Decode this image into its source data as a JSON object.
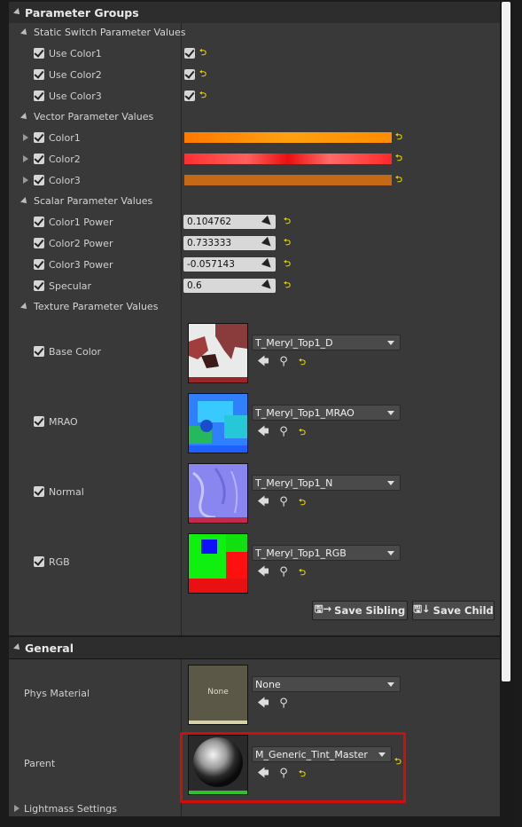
{
  "param_groups": {
    "header": "Parameter Groups",
    "static_switch": {
      "title": "Static Switch Parameter Values",
      "items": [
        "Use Color1",
        "Use Color2",
        "Use Color3"
      ]
    },
    "vector": {
      "title": "Vector Parameter Values",
      "items": [
        {
          "label": "Color1",
          "color": "#ff8c00"
        },
        {
          "label": "Color2",
          "color": "#ff2020"
        },
        {
          "label": "Color3",
          "color": "#c46a14"
        }
      ]
    },
    "scalar": {
      "title": "Scalar Parameter Values",
      "items": [
        {
          "label": "Color1 Power",
          "value": "0.104762"
        },
        {
          "label": "Color2 Power",
          "value": "0.733333"
        },
        {
          "label": "Color3 Power",
          "value": "-0.057143"
        },
        {
          "label": "Specular",
          "value": "0.6"
        }
      ]
    },
    "texture": {
      "title": "Texture Parameter Values",
      "items": [
        {
          "label": "Base Color",
          "asset": "T_Meryl_Top1_D"
        },
        {
          "label": "MRAO",
          "asset": "T_Meryl_Top1_MRAO"
        },
        {
          "label": "Normal",
          "asset": "T_Meryl_Top1_N"
        },
        {
          "label": "RGB",
          "asset": "T_Meryl_Top1_RGB"
        }
      ]
    },
    "save_sibling": "Save Sibling",
    "save_child": "Save Child"
  },
  "general": {
    "header": "General",
    "phys_material": {
      "label": "Phys Material",
      "value": "None",
      "thumb_text": "None"
    },
    "parent": {
      "label": "Parent",
      "value": "M_Generic_Tint_Master"
    },
    "lightmass": "Lightmass Settings"
  },
  "colors": {
    "highlight": "#d10d0d",
    "reset_arrow": "#e4d000"
  }
}
